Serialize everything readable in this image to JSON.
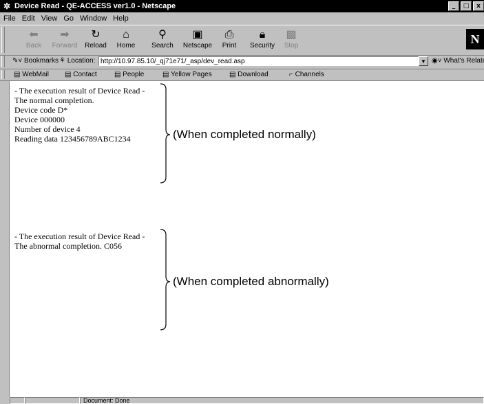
{
  "window": {
    "title": "Device Read - QE-ACCESS ver1.0 - Netscape",
    "minimize_glyph": "_",
    "maximize_glyph": "□",
    "close_glyph": "x"
  },
  "menu": [
    "File",
    "Edit",
    "View",
    "Go",
    "Window",
    "Help"
  ],
  "toolbar": {
    "buttons": [
      {
        "label": "Back",
        "icon": "back-arrow-icon",
        "enabled": false
      },
      {
        "label": "Forward",
        "icon": "forward-arrow-icon",
        "enabled": false
      },
      {
        "label": "Reload",
        "icon": "reload-icon",
        "enabled": true
      },
      {
        "label": "Home",
        "icon": "home-icon",
        "enabled": true
      },
      {
        "label": "Search",
        "icon": "search-icon",
        "enabled": true
      },
      {
        "label": "Netscape",
        "icon": "netscape-icon",
        "enabled": true
      },
      {
        "label": "Print",
        "icon": "print-icon",
        "enabled": true
      },
      {
        "label": "Security",
        "icon": "lock-icon",
        "enabled": true
      },
      {
        "label": "Stop",
        "icon": "stop-icon",
        "enabled": false
      }
    ],
    "logo_text": "N"
  },
  "location_bar": {
    "bookmarks_label": "Bookmarks",
    "location_label": "Location:",
    "url": "http://10.97.85.10/_qj71e71/_asp/dev_read.asp",
    "related_label": "What's Related"
  },
  "personal_toolbar": [
    "WebMail",
    "Contact",
    "People",
    "Yellow Pages",
    "Download",
    "Channels"
  ],
  "content": {
    "normal_result": [
      "- The execution result of Device Read -",
      "The normal completion.",
      "Device code D*",
      "Device 000000",
      "Number of device 4",
      "Reading data 123456789ABC1234"
    ],
    "abnormal_result": [
      "- The execution result of Device Read -",
      "The abnormal completion. C056"
    ],
    "normal_callout": "(When completed normally)",
    "abnormal_callout": "(When completed abnormally)"
  },
  "status_bar": {
    "text": "Document: Done"
  }
}
